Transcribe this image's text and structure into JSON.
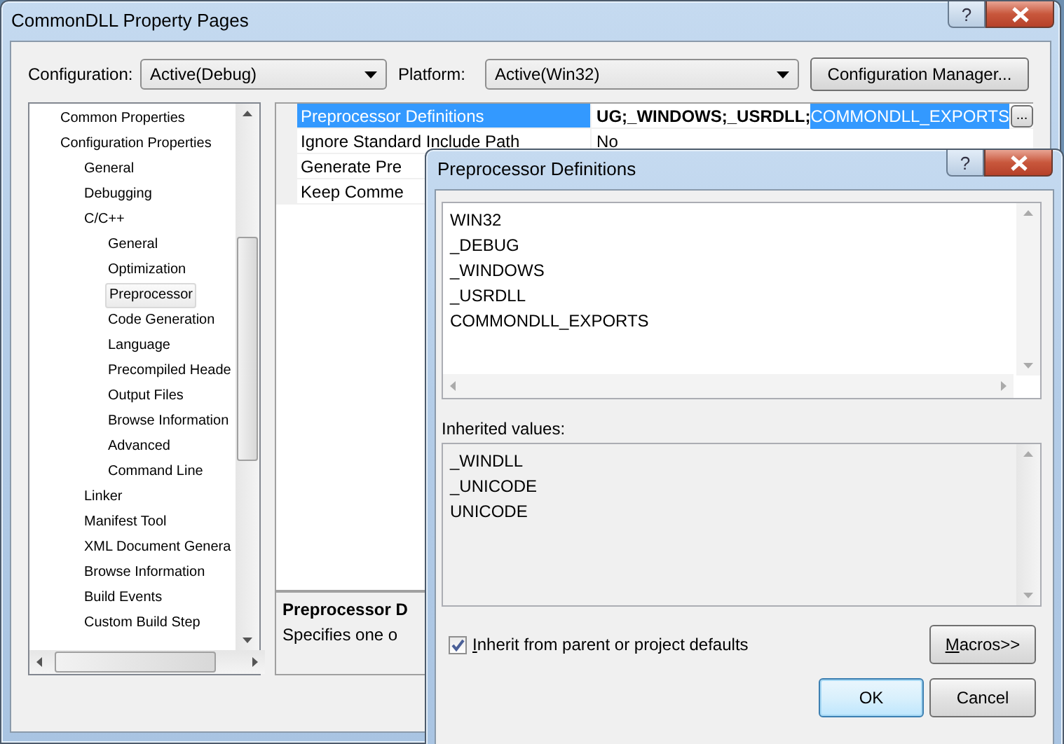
{
  "window": {
    "title": "CommonDLL Property Pages",
    "help": "?"
  },
  "configuration": {
    "label": "Configuration:",
    "value": "Active(Debug)"
  },
  "platform": {
    "label": "Platform:",
    "value": "Active(Win32)"
  },
  "config_manager_button": "Configuration Manager...",
  "tree": [
    {
      "label": "Common Properties",
      "selected": false
    },
    {
      "label": "Configuration Properties",
      "selected": false,
      "children": [
        {
          "label": "General",
          "selected": false
        },
        {
          "label": "Debugging",
          "selected": false
        },
        {
          "label": "C/C++",
          "selected": false,
          "children": [
            {
              "label": "General",
              "selected": false
            },
            {
              "label": "Optimization",
              "selected": false
            },
            {
              "label": "Preprocessor",
              "selected": true
            },
            {
              "label": "Code Generation",
              "selected": false
            },
            {
              "label": "Language",
              "selected": false
            },
            {
              "label": "Precompiled Heade",
              "selected": false
            },
            {
              "label": "Output Files",
              "selected": false
            },
            {
              "label": "Browse Information",
              "selected": false
            },
            {
              "label": "Advanced",
              "selected": false
            },
            {
              "label": "Command Line",
              "selected": false
            }
          ]
        },
        {
          "label": "Linker",
          "selected": false
        },
        {
          "label": "Manifest Tool",
          "selected": false
        },
        {
          "label": "XML Document Genera",
          "selected": false
        },
        {
          "label": "Browse Information",
          "selected": false
        },
        {
          "label": "Build Events",
          "selected": false
        },
        {
          "label": "Custom Build Step",
          "selected": false
        }
      ]
    }
  ],
  "properties": [
    {
      "name": "Preprocessor Definitions",
      "value": "UG;_WINDOWS;_USRDLL;",
      "selected_text": "COMMONDLL_EXPORTS",
      "ellipsis": "...",
      "selected": true
    },
    {
      "name": "Ignore Standard Include Path",
      "value": "No",
      "selected": false
    },
    {
      "name": "Generate Pre",
      "selected": false
    },
    {
      "name": "Keep Comme",
      "selected": false
    }
  ],
  "description": {
    "title": "Preprocessor D",
    "text": "Specifies one o"
  },
  "dialog": {
    "title": "Preprocessor Definitions",
    "help": "?",
    "definitions": [
      "WIN32",
      "_DEBUG",
      "_WINDOWS",
      "_USRDLL",
      "COMMONDLL_EXPORTS"
    ],
    "inherited_label": "Inherited values:",
    "inherited": [
      "_WINDLL",
      "_UNICODE",
      "UNICODE"
    ],
    "inherit_checkbox": {
      "label": "Inherit from parent or project defaults",
      "checked": true
    },
    "macros_button": "Macros>>",
    "ok_button": "OK",
    "cancel_button": "Cancel"
  }
}
